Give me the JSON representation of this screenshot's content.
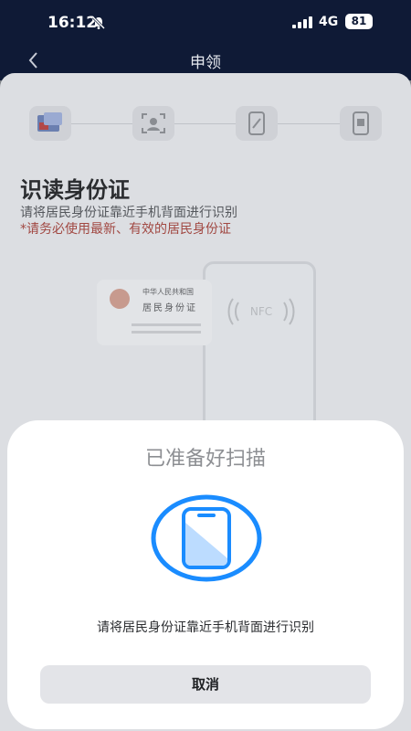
{
  "status_bar": {
    "time": "16:12",
    "network": "4G",
    "battery": "81"
  },
  "nav": {
    "title": "申领",
    "back_icon": "chevron-left-icon"
  },
  "steps": [
    {
      "icon": "id-card-icon"
    },
    {
      "icon": "face-scan-icon"
    },
    {
      "icon": "phone-sign-icon"
    },
    {
      "icon": "phone-nfc-icon"
    }
  ],
  "section": {
    "title": "识读身份证",
    "description": "请将居民身份证靠近手机背面进行识别",
    "warning": "*请务必使用最新、有效的居民身份证"
  },
  "illustration": {
    "card_line1": "中华人民共和国",
    "card_line2": "居民身份证",
    "nfc": "NFC"
  },
  "sheet": {
    "title": "已准备好扫描",
    "hint": "请将居民身份证靠近手机背面进行识别",
    "cancel_label": "取消",
    "accent_color": "#1a8cff"
  }
}
